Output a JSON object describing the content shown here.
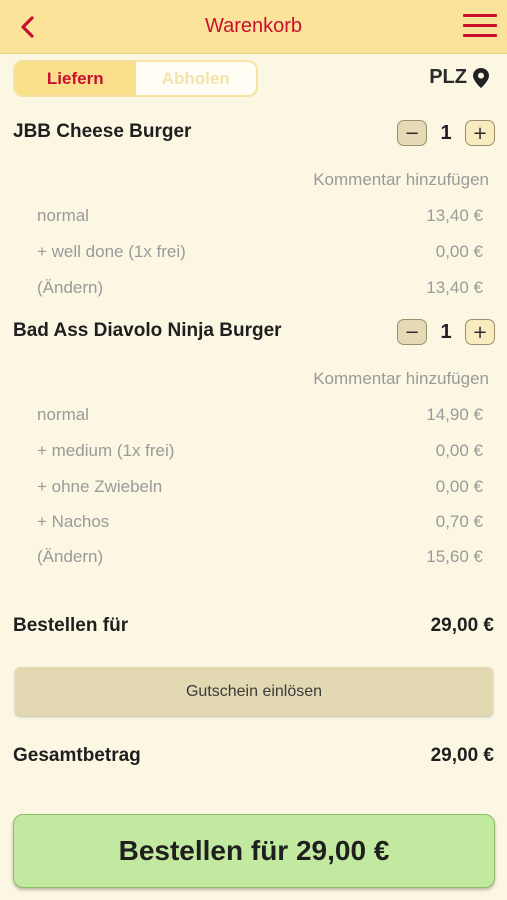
{
  "header": {
    "title": "Warenkorb",
    "back_icon": "chevron-left-icon",
    "menu_icon": "hamburger-menu-icon",
    "accent_color": "#c8102e"
  },
  "delivery_toggle": {
    "deliver_label": "Liefern",
    "pickup_label": "Abholen",
    "selected": "Liefern"
  },
  "plz": {
    "label": "PLZ",
    "icon": "location-pin-icon"
  },
  "items": [
    {
      "name": "JBB Cheese Burger",
      "quantity": "1",
      "comment_label": "Kommentar hinzufügen",
      "lines": [
        {
          "label": "normal",
          "price": "13,40 €"
        },
        {
          "label": "+ well done (1x frei)",
          "price": "0,00 €"
        },
        {
          "label": "(Ändern)",
          "price": "13,40 €"
        }
      ]
    },
    {
      "name": "Bad Ass Diavolo Ninja Burger",
      "quantity": "1",
      "comment_label": "Kommentar hinzufügen",
      "lines": [
        {
          "label": "normal",
          "price": "14,90 €"
        },
        {
          "label": "+ medium (1x frei)",
          "price": "0,00 €"
        },
        {
          "label": "+ ohne Zwiebeln",
          "price": "0,00 €"
        },
        {
          "label": "+ Nachos",
          "price": "0,70 €"
        },
        {
          "label": "(Ändern)",
          "price": "15,60 €"
        }
      ]
    }
  ],
  "order_for": {
    "label": "Bestellen für",
    "value": "29,00 €"
  },
  "voucher_label": "Gutschein einlösen",
  "total": {
    "label": "Gesamtbetrag",
    "value": "29,00 €"
  },
  "order_button_label": "Bestellen für 29,00 €"
}
